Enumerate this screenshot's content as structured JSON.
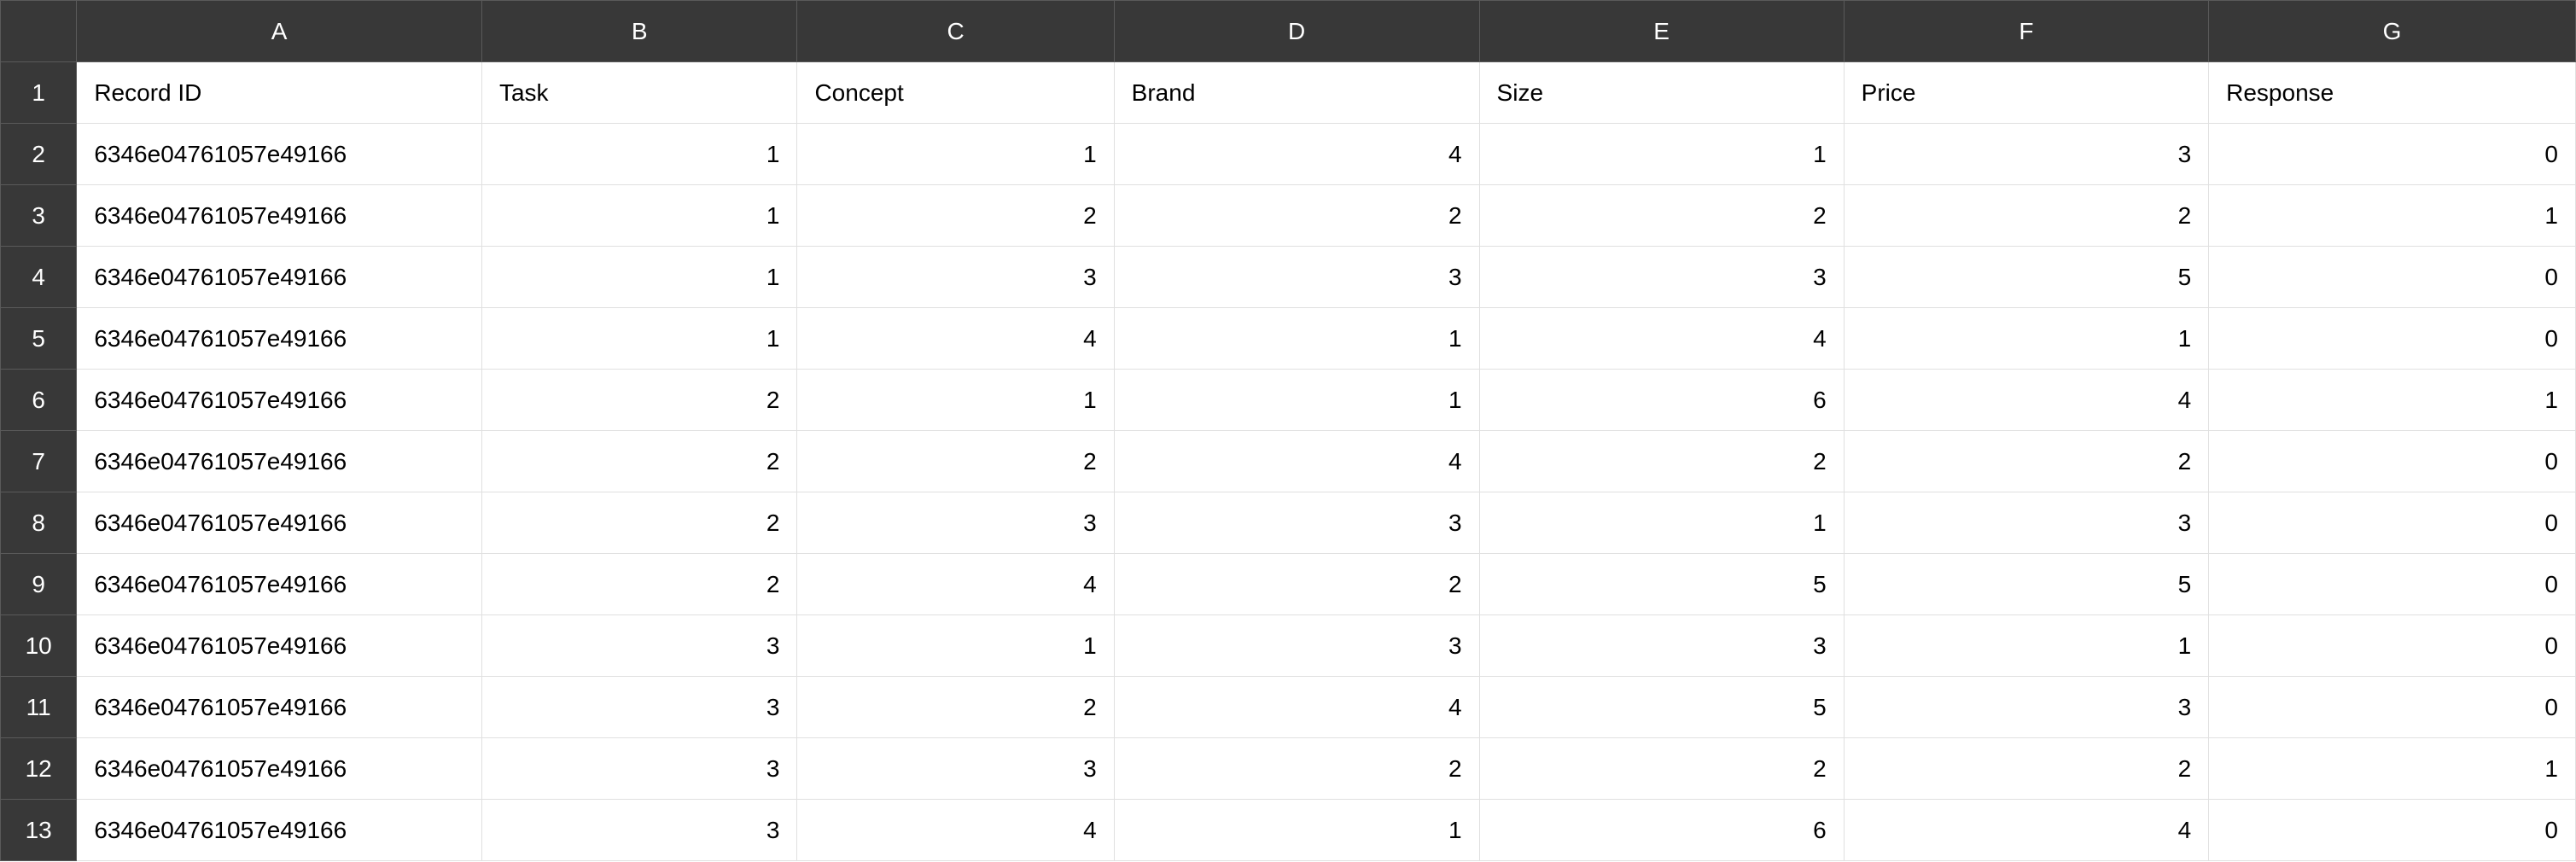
{
  "columns": [
    "A",
    "B",
    "C",
    "D",
    "E",
    "F",
    "G"
  ],
  "rowNumbers": [
    "1",
    "2",
    "3",
    "4",
    "5",
    "6",
    "7",
    "8",
    "9",
    "10",
    "11",
    "12",
    "13"
  ],
  "headers": [
    "Record ID",
    "Task",
    "Concept",
    "Brand",
    "Size",
    "Price",
    "Response"
  ],
  "rows": [
    [
      "6346e04761057e49166",
      "1",
      "1",
      "4",
      "1",
      "3",
      "0"
    ],
    [
      "6346e04761057e49166",
      "1",
      "2",
      "2",
      "2",
      "2",
      "1"
    ],
    [
      "6346e04761057e49166",
      "1",
      "3",
      "3",
      "3",
      "5",
      "0"
    ],
    [
      "6346e04761057e49166",
      "1",
      "4",
      "1",
      "4",
      "1",
      "0"
    ],
    [
      "6346e04761057e49166",
      "2",
      "1",
      "1",
      "6",
      "4",
      "1"
    ],
    [
      "6346e04761057e49166",
      "2",
      "2",
      "4",
      "2",
      "2",
      "0"
    ],
    [
      "6346e04761057e49166",
      "2",
      "3",
      "3",
      "1",
      "3",
      "0"
    ],
    [
      "6346e04761057e49166",
      "2",
      "4",
      "2",
      "5",
      "5",
      "0"
    ],
    [
      "6346e04761057e49166",
      "3",
      "1",
      "3",
      "3",
      "1",
      "0"
    ],
    [
      "6346e04761057e49166",
      "3",
      "2",
      "4",
      "5",
      "3",
      "0"
    ],
    [
      "6346e04761057e49166",
      "3",
      "3",
      "2",
      "2",
      "2",
      "1"
    ],
    [
      "6346e04761057e49166",
      "3",
      "4",
      "1",
      "6",
      "4",
      "0"
    ]
  ]
}
